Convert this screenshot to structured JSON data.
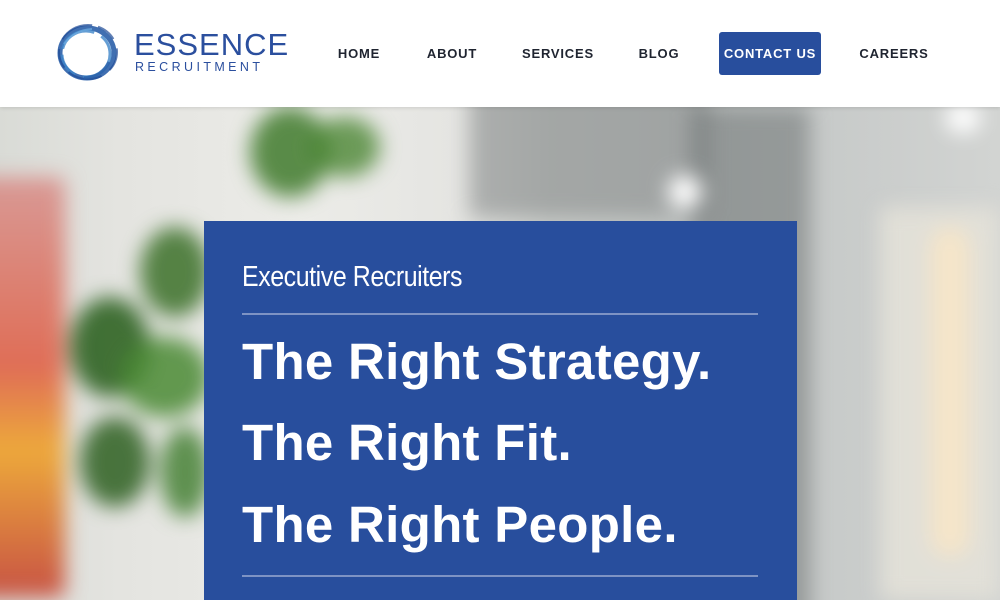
{
  "brand": {
    "name": "ESSENCE",
    "tagline": "RECRUITMENT",
    "logo_icon": "circle-brush-logo-icon",
    "color": "#2b4f9e"
  },
  "nav": {
    "items": [
      {
        "label": "HOME"
      },
      {
        "label": "ABOUT"
      },
      {
        "label": "SERVICES"
      },
      {
        "label": "BLOG"
      },
      {
        "label": "CONTACT US",
        "active": true
      },
      {
        "label": "CAREERS"
      }
    ],
    "accent": "#284e9d"
  },
  "hero": {
    "eyebrow": "Executive Recruiters",
    "lines": [
      "The Right Strategy.",
      "The Right Fit.",
      "The Right People."
    ],
    "card_color": "#284e9d"
  }
}
